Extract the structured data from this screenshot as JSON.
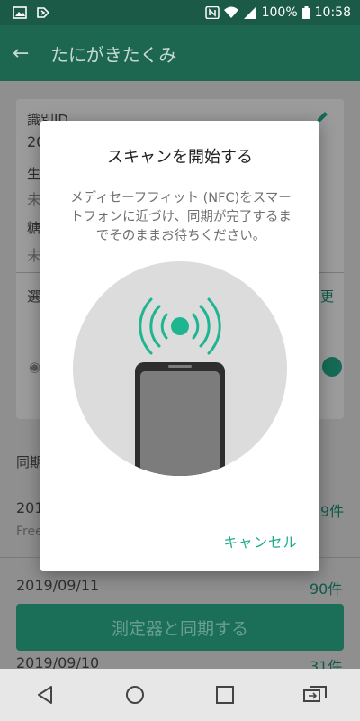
{
  "status": {
    "battery": "100%",
    "time": "10:58"
  },
  "appbar": {
    "title": "たにがきたくみ"
  },
  "background": {
    "id_label": "識別ID",
    "id_value_partial": "20",
    "row1_label_partial": "生",
    "row1_value_partial": "未",
    "row2_label_partial": "糖",
    "row2_value_partial": "未",
    "section_partial": "選",
    "change_partial": "更",
    "sync_header_partial": "同期",
    "item1_date_partial": "2019",
    "item1_sub_partial": "Free",
    "item1_count_partial": "9件",
    "item2_date": "2019/09/11",
    "item2_count": "90件",
    "item3_date": "2019/09/10",
    "item3_count": "31件",
    "sync_button": "測定器と同期する"
  },
  "dialog": {
    "title": "スキャンを開始する",
    "message": "メディセーフフィット (NFC)をスマートフォンに近づけ、同期が完了するまでそのままお待ちください。",
    "cancel": "キャンセル"
  },
  "colors": {
    "accent": "#1eaa8e",
    "appbar": "#1d6650",
    "statusbar": "#1a5a46"
  }
}
